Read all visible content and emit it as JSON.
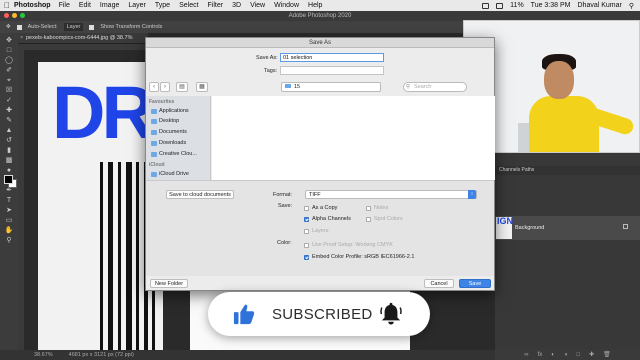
{
  "menubar": {
    "app": "Photoshop",
    "items": [
      "File",
      "Edit",
      "Image",
      "Layer",
      "Type",
      "Select",
      "Filter",
      "3D",
      "View",
      "Window",
      "Help"
    ],
    "battery": "11%",
    "clock": "Tue 3:38 PM",
    "user": "Dhaval Kumar"
  },
  "photoshop": {
    "window_title": "Adobe Photoshop 2020",
    "options": {
      "auto_select_label": "Auto-Select:",
      "auto_select_value": "Layer",
      "transform_label": "Show Transform Controls"
    },
    "document_tab": "pexels-kaboompics-com-6444.jpg @ 38.7%",
    "canvas_text": "DR",
    "status_zoom": "38.67%",
    "status_size": "4681 px x 3121 px (72 ppi)",
    "panel_tabs": "Channels  Paths",
    "layer_name": "Background"
  },
  "dialog": {
    "title": "Save As",
    "save_as_label": "Save As:",
    "save_as_value": "01 selection",
    "tags_label": "Tags:",
    "folder": "15",
    "search_placeholder": "Search",
    "sidebar": {
      "favorites_heading": "Favourites",
      "favorites": [
        "Applications",
        "Desktop",
        "Documents",
        "Downloads",
        "Creative Clou..."
      ],
      "icloud_heading": "iCloud",
      "icloud": [
        "iCloud Drive"
      ]
    },
    "cloud_button": "Save to cloud documents",
    "format_label": "Format:",
    "format_value": "TIFF",
    "save_label": "Save:",
    "options": {
      "as_a_copy": "As a Copy",
      "notes": "Notes",
      "alpha_channels": "Alpha Channels",
      "spot_colors": "Spot Colors",
      "layers": "Layers"
    },
    "color_label": "Color:",
    "use_proof": "Use Proof Setup:  Working CMYK",
    "embed_profile": "Embed Color Profile:  sRGB IEC61966-2.1",
    "new_folder": "New Folder",
    "cancel": "Cancel",
    "save": "Save"
  },
  "overlay": {
    "subscribed": "SUBSCRIBED"
  },
  "colors": {
    "accent_blue": "#3d84e6",
    "canvas_blue": "#1f45e8",
    "shirt_yellow": "#f2d21a"
  }
}
